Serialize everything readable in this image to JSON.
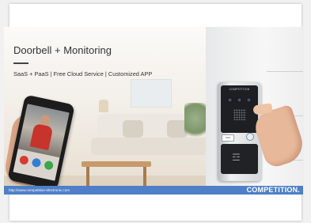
{
  "slide": {
    "title": "Doorbell + Monitoring",
    "subtitle": "SaaS + PaaS | Free Cloud Service | Customized APP"
  },
  "intercom": {
    "brand_text": "COMPETITION",
    "button_label": "SOS"
  },
  "footer": {
    "url": "http://www.competition-electronic.com",
    "brand": "COMPETITION."
  },
  "icons": {
    "camera_lens": "camera-lens-icon",
    "doorbell": "doorbell-button-icon",
    "rfid": "rfid-card-icon",
    "call_buttons": [
      "hangup-icon",
      "unlock-icon",
      "answer-icon"
    ]
  },
  "colors": {
    "footer_bar": "#4e7fc7",
    "title_text": "#333333"
  }
}
